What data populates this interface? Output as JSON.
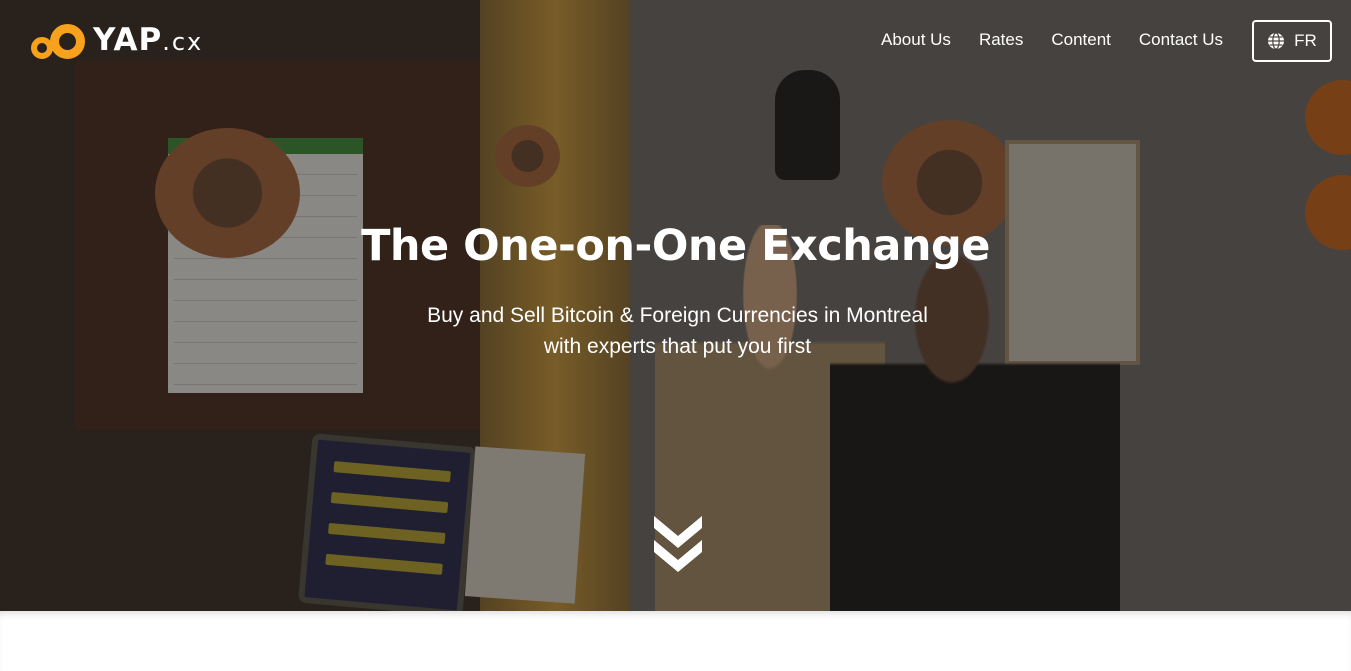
{
  "brand": {
    "name": "YAP",
    "suffix": ".cx",
    "accent": "#f7a11d"
  },
  "nav": {
    "items": [
      {
        "label": "About Us"
      },
      {
        "label": "Rates"
      },
      {
        "label": "Content"
      },
      {
        "label": "Contact Us"
      }
    ]
  },
  "language": {
    "icon": "globe-icon",
    "label": "FR"
  },
  "hero": {
    "title": "The One-on-One Exchange",
    "subtitle_line1": "Buy and Sell Bitcoin & Foreign Currencies in Montreal",
    "subtitle_line2": "with experts that put you first",
    "scroll_icon": "double-chevron-down-icon"
  }
}
